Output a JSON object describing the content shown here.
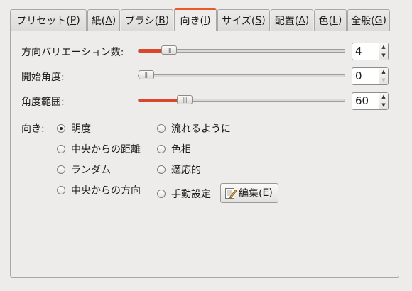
{
  "tabs": [
    {
      "label": "プリセット(",
      "mnemonic": "P",
      "close": ")"
    },
    {
      "label": "紙(",
      "mnemonic": "A",
      "close": ")"
    },
    {
      "label": "ブラシ(",
      "mnemonic": "B",
      "close": ")"
    },
    {
      "label": "向き(",
      "mnemonic": "I",
      "close": ")"
    },
    {
      "label": "サイズ(",
      "mnemonic": "S",
      "close": ")"
    },
    {
      "label": "配置(",
      "mnemonic": "A",
      "close": ")"
    },
    {
      "label": "色(",
      "mnemonic": "L",
      "close": ")"
    },
    {
      "label": "全般(",
      "mnemonic": "G",
      "close": ")"
    }
  ],
  "active_tab_index": 3,
  "accent_color": "#e65a2c",
  "sliders": {
    "variations": {
      "label": "方向バリエーション数:",
      "value": "4",
      "fraction": 0.12
    },
    "start_angle": {
      "label": "開始角度:",
      "value": "0",
      "fraction": 0.0
    },
    "angle_span": {
      "label": "角度範囲:",
      "value": "60",
      "fraction": 0.2
    }
  },
  "orientation": {
    "label": "向き:",
    "selected": "明度",
    "options_left": [
      "明度",
      "中央からの距離",
      "ランダム",
      "中央からの方向"
    ],
    "options_right": [
      "流れるように",
      "色相",
      "適応的",
      "手動設定"
    ]
  },
  "edit_button": {
    "label": "編集(",
    "mnemonic": "E",
    "close": ")",
    "icon": "edit-pencil-icon"
  }
}
